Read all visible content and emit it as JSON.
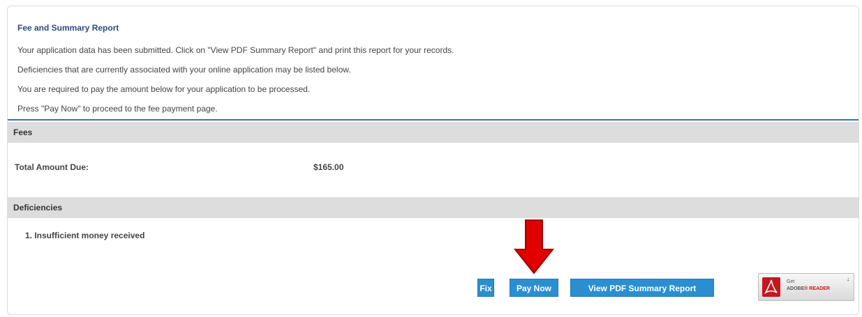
{
  "report": {
    "title": "Fee and Summary Report",
    "lines": [
      "Your application data has been submitted. Click on \"View PDF Summary Report\" and print this report for your records.",
      "Deficiencies that are currently associated with your online application may be listed below.",
      "You are required to pay the amount below for your application to be processed.",
      "Press \"Pay Now\" to proceed to the fee payment page."
    ]
  },
  "fees": {
    "header": "Fees",
    "total_label": "Total Amount Due:",
    "total_value": "$165.00"
  },
  "deficiencies": {
    "header": "Deficiencies",
    "items": [
      "1. Insufficient money received"
    ]
  },
  "actions": {
    "fix_label": "Fix",
    "pay_label": "Pay Now",
    "pdf_label": "View PDF Summary Report"
  },
  "adobe": {
    "get_text": "Get",
    "brand_text": "ADOBE",
    "reader_text": "READER",
    "icon": "download-icon"
  },
  "colors": {
    "title": "#2b4c7e",
    "accent_rule": "#3a6fa6",
    "section_header_bg": "#dddddd",
    "button_bg": "#2a8fd0",
    "arrow": "#e00000",
    "adobe_red": "#c8161d"
  }
}
